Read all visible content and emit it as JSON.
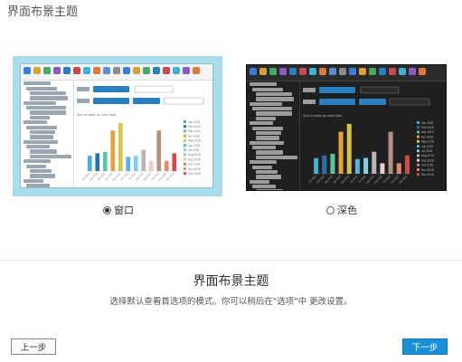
{
  "page": {
    "title": "界面布景主题",
    "heading": "界面布景主题",
    "description": "选择默认查看首选项的模式。你可以稍后在\"选项\"中 更改设置。"
  },
  "themes": [
    {
      "id": "window",
      "label": "窗口",
      "selected": true
    },
    {
      "id": "dark",
      "label": "深色",
      "selected": false
    }
  ],
  "buttons": {
    "prev": "上一步",
    "next": "下一步"
  },
  "colors": {
    "accent": "#1a8fd6",
    "window_bg": "#a9dcec",
    "dark_bg": "#1f1f1f"
  },
  "preview": {
    "chart_title": "Sum of sales by order date",
    "months": [
      "Jan 2018",
      "Feb 2018",
      "Mar 2018",
      "Apr 2018",
      "May 2018",
      "Jun 2018",
      "Jul 2018",
      "Aug 2018",
      "Sep 2018",
      "Oct 2018",
      "Nov 2018",
      "Dec 2018"
    ],
    "values": [
      30,
      35,
      38,
      80,
      95,
      28,
      30,
      42,
      20,
      80,
      20,
      35
    ],
    "colors": [
      "#3fb0d6",
      "#2c6fa8",
      "#5cc2a6",
      "#e8a23a",
      "#d9c24a",
      "#52b4e0",
      "#7fd0e8",
      "#b6b6b6",
      "#f0c8d0",
      "#b59080",
      "#e88a6a",
      "#d24a4a"
    ]
  }
}
